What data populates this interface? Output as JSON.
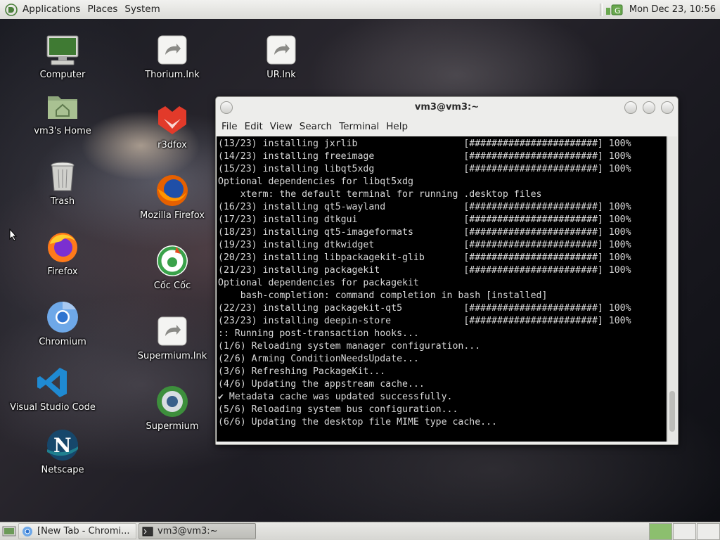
{
  "top_panel": {
    "menus": [
      "Applications",
      "Places",
      "System"
    ],
    "clock": "Mon Dec 23, 10:56"
  },
  "desktop": {
    "left_icons": [
      {
        "label": "Computer",
        "icon": "computer-icon"
      },
      {
        "label": "vm3's Home",
        "icon": "home-folder-icon"
      },
      {
        "label": "Trash",
        "icon": "trash-icon"
      },
      {
        "label": "Firefox",
        "icon": "firefox-icon"
      },
      {
        "label": "Chromium",
        "icon": "chromium-icon"
      },
      {
        "label": "Visual Studio Code",
        "icon": "vscode-icon"
      },
      {
        "label": "Netscape",
        "icon": "netscape-icon"
      }
    ],
    "middle_icons": [
      {
        "label": "Thorium.lnk",
        "icon": "shortcut-icon"
      },
      {
        "label": "r3dfox",
        "icon": "r3dfox-icon"
      },
      {
        "label": "Mozilla Firefox",
        "icon": "firefox-icon"
      },
      {
        "label": "Cốc Cốc",
        "icon": "coccoc-icon"
      },
      {
        "label": "Supermium.lnk",
        "icon": "shortcut-icon"
      },
      {
        "label": "Supermium",
        "icon": "supermium-icon"
      }
    ],
    "right_icons": [
      {
        "label": "UR.lnk",
        "icon": "shortcut-icon"
      }
    ]
  },
  "terminal": {
    "title": "vm3@vm3:~",
    "menu": [
      "File",
      "Edit",
      "View",
      "Search",
      "Terminal",
      "Help"
    ],
    "lines": [
      "(13/23) installing jxrlib                   [#######################] 100%",
      "(14/23) installing freeimage                [#######################] 100%",
      "(15/23) installing libqt5xdg                [#######################] 100%",
      "Optional dependencies for libqt5xdg",
      "    xterm: the default terminal for running .desktop files",
      "(16/23) installing qt5-wayland              [#######################] 100%",
      "(17/23) installing dtkgui                   [#######################] 100%",
      "(18/23) installing qt5-imageformats         [#######################] 100%",
      "(19/23) installing dtkwidget                [#######################] 100%",
      "(20/23) installing libpackagekit-glib       [#######################] 100%",
      "(21/23) installing packagekit               [#######################] 100%",
      "Optional dependencies for packagekit",
      "    bash-completion: command completion in bash [installed]",
      "(22/23) installing packagekit-qt5           [#######################] 100%",
      "(23/23) installing deepin-store             [#######################] 100%",
      ":: Running post-transaction hooks...",
      "(1/6) Reloading system manager configuration...",
      "(2/6) Arming ConditionNeedsUpdate...",
      "(3/6) Refreshing PackageKit...",
      "(4/6) Updating the appstream cache...",
      "✔ Metadata cache was updated successfully.",
      "(5/6) Reloading system bus configuration...",
      "(6/6) Updating the desktop file MIME type cache..."
    ]
  },
  "taskbar": {
    "tasks": [
      {
        "label": "[New Tab - Chromi...",
        "icon": "chromium-icon",
        "active": false
      },
      {
        "label": "vm3@vm3:~",
        "icon": "terminal-icon",
        "active": true
      }
    ]
  },
  "colors": {
    "panel": "#dcdcd8",
    "terminal_bg": "#000000",
    "terminal_fg": "#d8d8d8",
    "workspace_active": "#8cbf6e"
  }
}
